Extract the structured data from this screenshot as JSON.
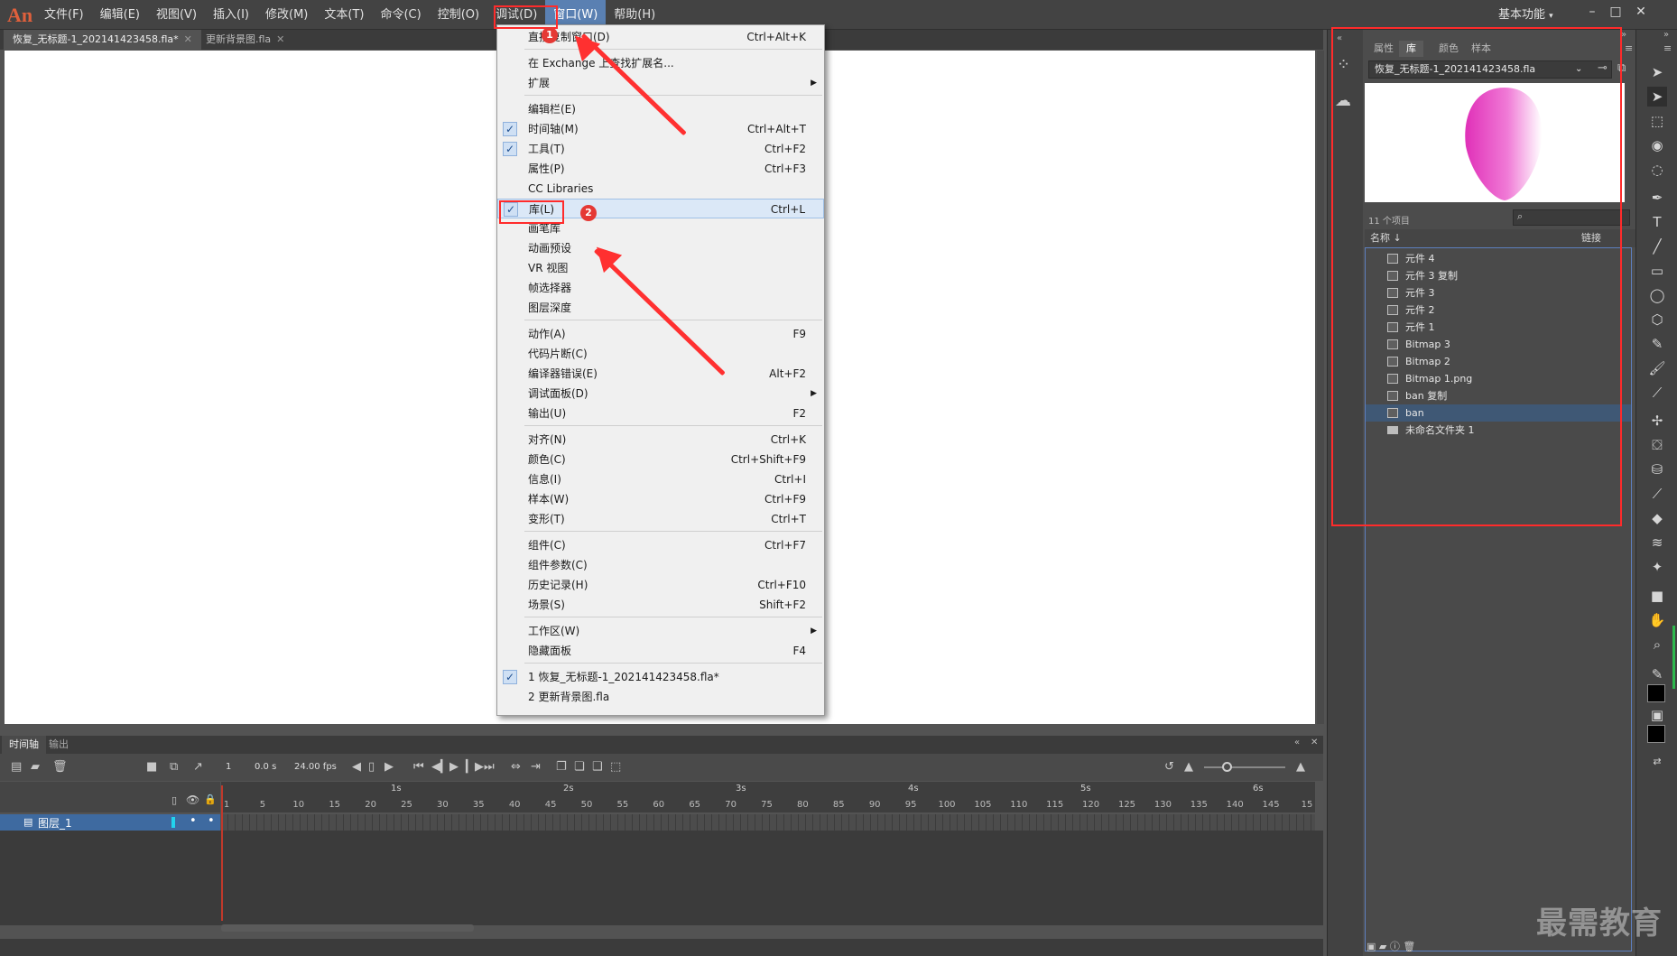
{
  "app": {
    "logo": "An",
    "workspace": "基本功能"
  },
  "menubar": {
    "items": [
      "文件(F)",
      "编辑(E)",
      "视图(V)",
      "插入(I)",
      "修改(M)",
      "文本(T)",
      "命令(C)",
      "控制(O)",
      "调试(D)",
      "窗口(W)",
      "帮助(H)"
    ],
    "active": "窗口(W)"
  },
  "doc_tabs": [
    "恢复_无标题-1_202141423458.fla*",
    "更新背景图.fla"
  ],
  "window_menu": {
    "items": [
      {
        "label": "直接复制窗口(D)",
        "shortcut": "Ctrl+Alt+K"
      },
      {
        "label": "在 Exchange 上查找扩展名..."
      },
      {
        "label": "扩展",
        "submenu": true
      },
      {
        "label": "编辑栏(E)"
      },
      {
        "label": "时间轴(M)",
        "shortcut": "Ctrl+Alt+T",
        "checked": true
      },
      {
        "label": "工具(T)",
        "shortcut": "Ctrl+F2",
        "checked": true
      },
      {
        "label": "属性(P)",
        "shortcut": "Ctrl+F3"
      },
      {
        "label": "CC Libraries"
      },
      {
        "label": "库(L)",
        "shortcut": "Ctrl+L",
        "checked": true,
        "highlighted": true
      },
      {
        "label": "画笔库"
      },
      {
        "label": "动画预设"
      },
      {
        "label": "VR 视图"
      },
      {
        "label": "帧选择器"
      },
      {
        "label": "图层深度"
      },
      {
        "label": "动作(A)",
        "shortcut": "F9"
      },
      {
        "label": "代码片断(C)"
      },
      {
        "label": "编译器错误(E)",
        "shortcut": "Alt+F2"
      },
      {
        "label": "调试面板(D)",
        "submenu": true
      },
      {
        "label": "输出(U)",
        "shortcut": "F2"
      },
      {
        "label": "对齐(N)",
        "shortcut": "Ctrl+K"
      },
      {
        "label": "颜色(C)",
        "shortcut": "Ctrl+Shift+F9"
      },
      {
        "label": "信息(I)",
        "shortcut": "Ctrl+I"
      },
      {
        "label": "样本(W)",
        "shortcut": "Ctrl+F9"
      },
      {
        "label": "变形(T)",
        "shortcut": "Ctrl+T"
      },
      {
        "label": "组件(C)",
        "shortcut": "Ctrl+F7"
      },
      {
        "label": "组件参数(C)"
      },
      {
        "label": "历史记录(H)",
        "shortcut": "Ctrl+F10"
      },
      {
        "label": "场景(S)",
        "shortcut": "Shift+F2"
      },
      {
        "label": "工作区(W)",
        "submenu": true
      },
      {
        "label": "隐藏面板",
        "shortcut": "F4"
      },
      {
        "label": "1 恢复_无标题-1_202141423458.fla*",
        "checked": true
      },
      {
        "label": "2 更新背景图.fla"
      }
    ]
  },
  "annotations": {
    "badge1": "1",
    "badge2": "2"
  },
  "timeline": {
    "tabs": [
      "时间轴",
      "输出"
    ],
    "frame": "1",
    "time": "0.0 s",
    "fps": "24.00 fps",
    "layer_name": "图层_1",
    "seconds": [
      "1s",
      "2s",
      "3s",
      "4s",
      "5s",
      "6s"
    ],
    "frame_numbers": [
      "1",
      "5",
      "10",
      "15",
      "20",
      "25",
      "30",
      "35",
      "40",
      "45",
      "50",
      "55",
      "60",
      "65",
      "70",
      "75",
      "80",
      "85",
      "90",
      "95",
      "100",
      "105",
      "110",
      "115",
      "120",
      "125",
      "130",
      "135",
      "140",
      "145",
      "15"
    ]
  },
  "library": {
    "tabs": [
      "属性",
      "库",
      "颜色",
      "样本"
    ],
    "active_tab": "库",
    "document": "恢复_无标题-1_202141423458.fla",
    "item_count": "11 个项目",
    "col_name": "名称 ↓",
    "col_link": "链接",
    "items": [
      {
        "name": "元件 4",
        "type": "symbol"
      },
      {
        "name": "元件 3 复制",
        "type": "symbol"
      },
      {
        "name": "元件 3",
        "type": "symbol"
      },
      {
        "name": "元件 2",
        "type": "symbol"
      },
      {
        "name": "元件 1",
        "type": "symbol"
      },
      {
        "name": "Bitmap 3",
        "type": "bitmap"
      },
      {
        "name": "Bitmap 2",
        "type": "bitmap"
      },
      {
        "name": "Bitmap 1.png",
        "type": "bitmap"
      },
      {
        "name": "ban 复制",
        "type": "symbol"
      },
      {
        "name": "ban",
        "type": "symbol",
        "selected": true
      },
      {
        "name": "未命名文件夹 1",
        "type": "folder"
      }
    ]
  },
  "watermark": "最需教育",
  "colors": {
    "menu_active": "#5a80b2",
    "annotation_red": "#ff2b2b",
    "selected_row": "#3f5875",
    "layer_row": "#3e6aa0"
  }
}
